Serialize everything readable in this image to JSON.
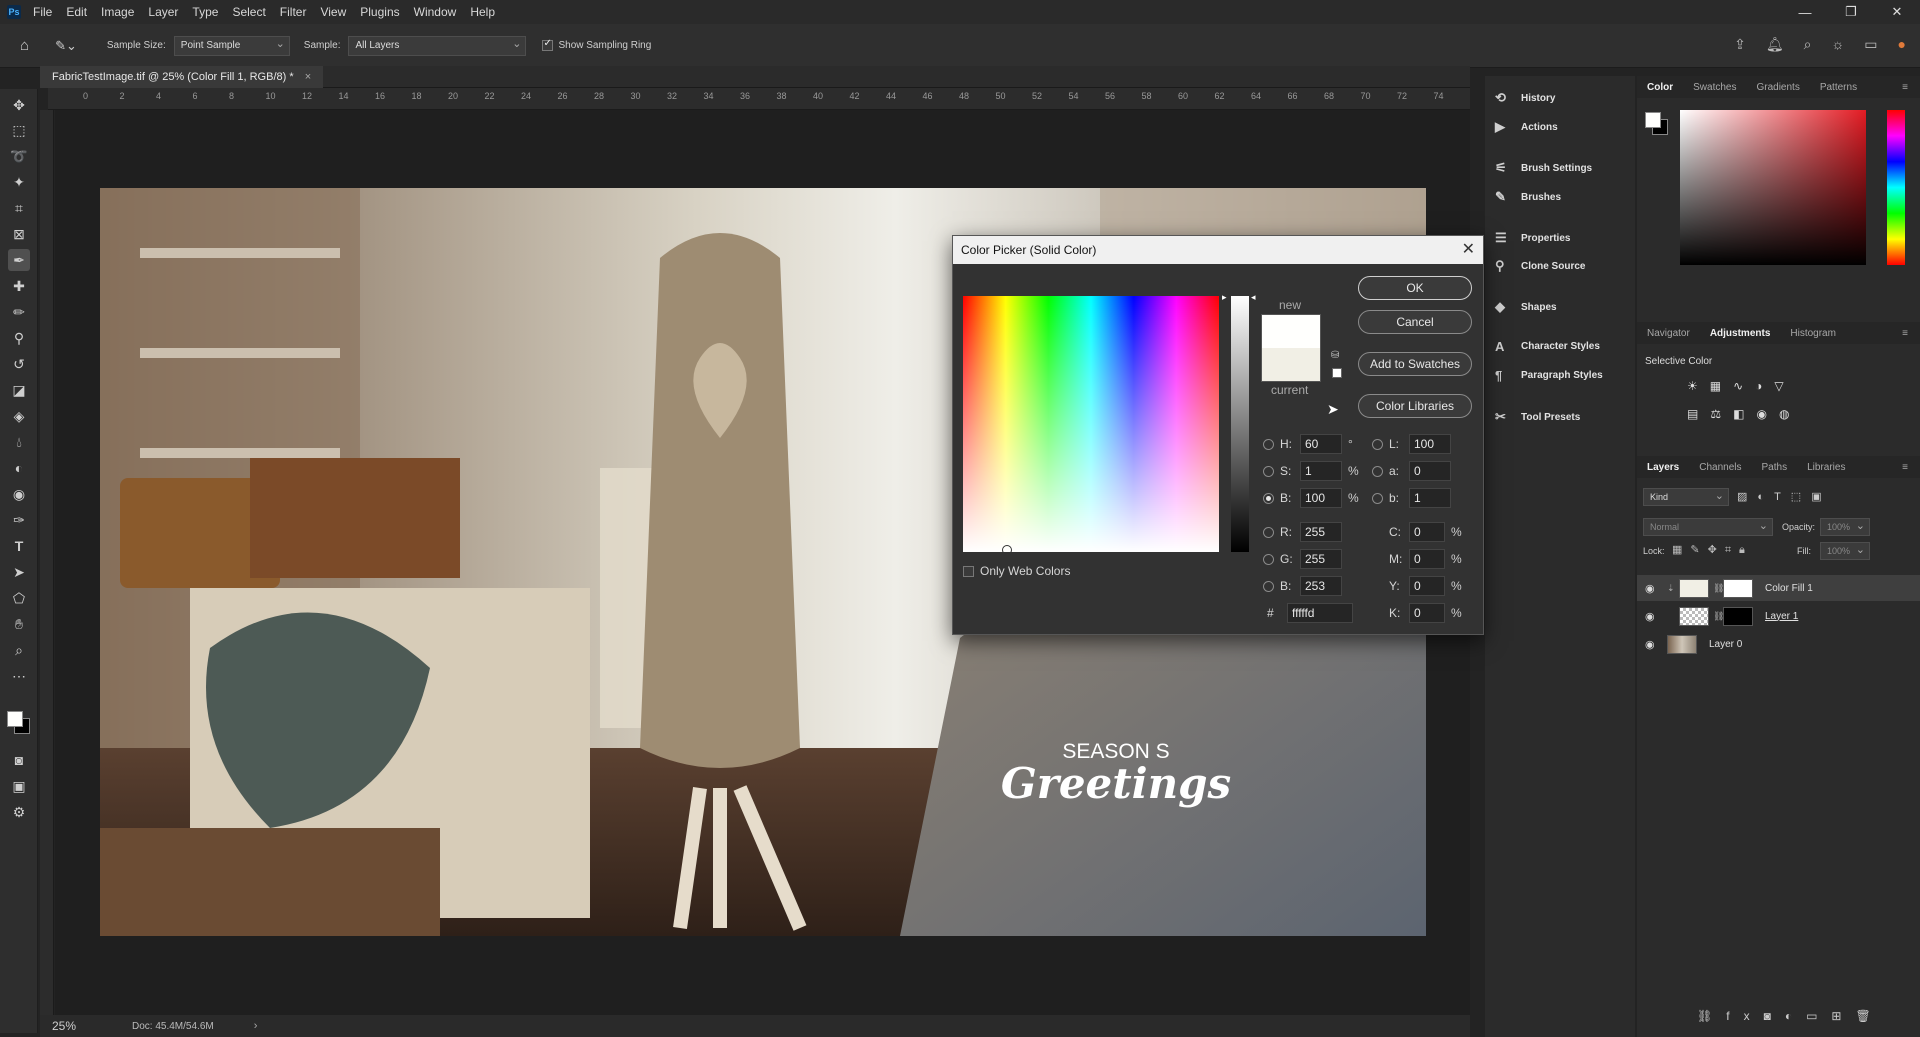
{
  "menu": {
    "logo": "Ps",
    "items": [
      "File",
      "Edit",
      "Image",
      "Layer",
      "Type",
      "Select",
      "Filter",
      "View",
      "Plugins",
      "Window",
      "Help"
    ],
    "window_controls": [
      "—",
      "❐",
      "✕"
    ]
  },
  "options": {
    "sample_size_label": "Sample Size:",
    "sample_size_value": "Point Sample",
    "sample_label": "Sample:",
    "sample_value": "All Layers",
    "show_ring_label": "Show Sampling Ring"
  },
  "document": {
    "tab_title": "FabricTestImage.tif @ 25% (Color Fill 1, RGB/8) *",
    "tab_close": "×",
    "ruler_labels": [
      "0",
      "2",
      "4",
      "6",
      "8",
      "10",
      "12",
      "14",
      "16",
      "18",
      "20",
      "22",
      "24",
      "26",
      "28",
      "30",
      "32",
      "34",
      "36",
      "38",
      "40",
      "42",
      "44",
      "46",
      "48",
      "50",
      "52",
      "54",
      "56",
      "58",
      "60",
      "62",
      "64",
      "66",
      "68",
      "70",
      "72",
      "74"
    ],
    "zoom": "25%",
    "doc_size": "Doc: 45.4M/54.6M",
    "overlay_line1": "SEASON S",
    "overlay_line2": "Greetings"
  },
  "mid_panel": {
    "items": [
      {
        "icon": "history-icon",
        "label": "History"
      },
      {
        "icon": "actions-icon",
        "label": "Actions"
      },
      {
        "icon": "brush-settings-icon",
        "label": "Brush Settings"
      },
      {
        "icon": "brushes-icon",
        "label": "Brushes"
      },
      {
        "icon": "properties-icon",
        "label": "Properties"
      },
      {
        "icon": "clone-source-icon",
        "label": "Clone Source"
      },
      {
        "icon": "shapes-icon",
        "label": "Shapes"
      },
      {
        "icon": "character-styles-icon",
        "label": "Character Styles"
      },
      {
        "icon": "paragraph-styles-icon",
        "label": "Paragraph Styles"
      },
      {
        "icon": "tool-presets-icon",
        "label": "Tool Presets"
      }
    ]
  },
  "right_panel": {
    "color_tabs": [
      "Color",
      "Swatches",
      "Gradients",
      "Patterns"
    ],
    "adj_tabs": [
      "Navigator",
      "Adjustments",
      "Histogram"
    ],
    "adj_label": "Selective Color",
    "layer_tabs": [
      "Layers",
      "Channels",
      "Paths",
      "Libraries"
    ],
    "kind_placeholder": "Kind",
    "blend_mode": "Normal",
    "opacity_label": "Opacity:",
    "opacity_value": "100%",
    "lock_label": "Lock:",
    "fill_label": "Fill:",
    "fill_value": "100%",
    "layers": [
      "Color Fill 1",
      "Layer 1",
      "Layer 0"
    ]
  },
  "dialog": {
    "title": "Color Picker (Solid Color)",
    "new_label": "new",
    "current_label": "current",
    "ok": "OK",
    "cancel": "Cancel",
    "add_swatches": "Add to Swatches",
    "color_libraries": "Color Libraries",
    "only_web": "Only Web Colors",
    "H": "60",
    "S": "1",
    "B": "100",
    "R": "255",
    "G": "255",
    "Bv": "253",
    "L": "100",
    "a": "0",
    "b": "1",
    "C": "0",
    "M": "0",
    "Y": "0",
    "K": "0",
    "hex": "fffffd",
    "units": {
      "deg": "°",
      "pct": "%",
      "hash": "#"
    }
  },
  "colors": {
    "new_color": "#fffffd",
    "current_color": "#f1efe5"
  }
}
